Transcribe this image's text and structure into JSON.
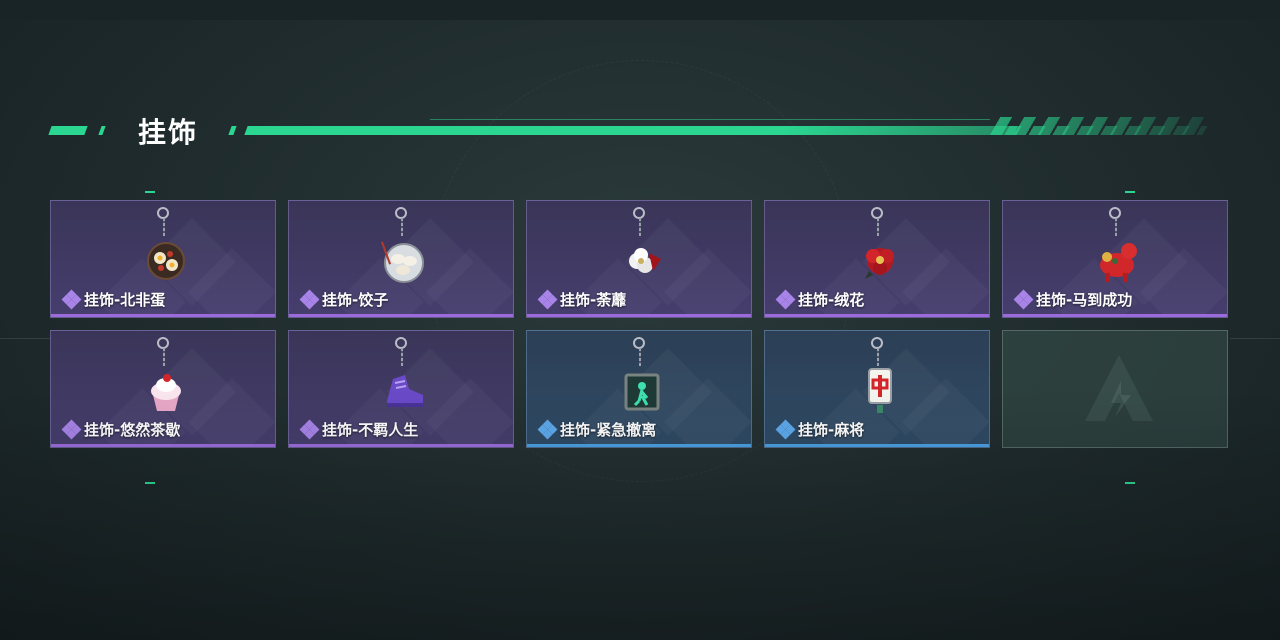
{
  "section": {
    "title": "挂饰"
  },
  "colors": {
    "accent_green": "#2bd690",
    "rarity_purple": "#9b6bdc",
    "rarity_blue": "#4aa0e4"
  },
  "items": [
    {
      "label": "挂饰-北非蛋",
      "rarity": "purple",
      "icon": "shakshuka-pan-charm-icon"
    },
    {
      "label": "挂饰-饺子",
      "rarity": "purple",
      "icon": "dumpling-plate-charm-icon"
    },
    {
      "label": "挂饰-荼蘼",
      "rarity": "purple",
      "icon": "white-flower-charm-icon"
    },
    {
      "label": "挂饰-绒花",
      "rarity": "purple",
      "icon": "red-velvet-flower-charm-icon"
    },
    {
      "label": "挂饰-马到成功",
      "rarity": "purple",
      "icon": "red-horse-charm-icon"
    },
    {
      "label": "挂饰-悠然茶歇",
      "rarity": "purple",
      "icon": "cupcake-charm-icon"
    },
    {
      "label": "挂饰-不羁人生",
      "rarity": "purple",
      "icon": "purple-sneaker-charm-icon"
    },
    {
      "label": "挂饰-紧急撤离",
      "rarity": "blue",
      "icon": "exit-sign-charm-icon"
    },
    {
      "label": "挂饰-麻将",
      "rarity": "blue",
      "icon": "mahjong-tile-charm-icon"
    }
  ],
  "empty_slot": {
    "icon": "game-logo-placeholder-icon"
  }
}
